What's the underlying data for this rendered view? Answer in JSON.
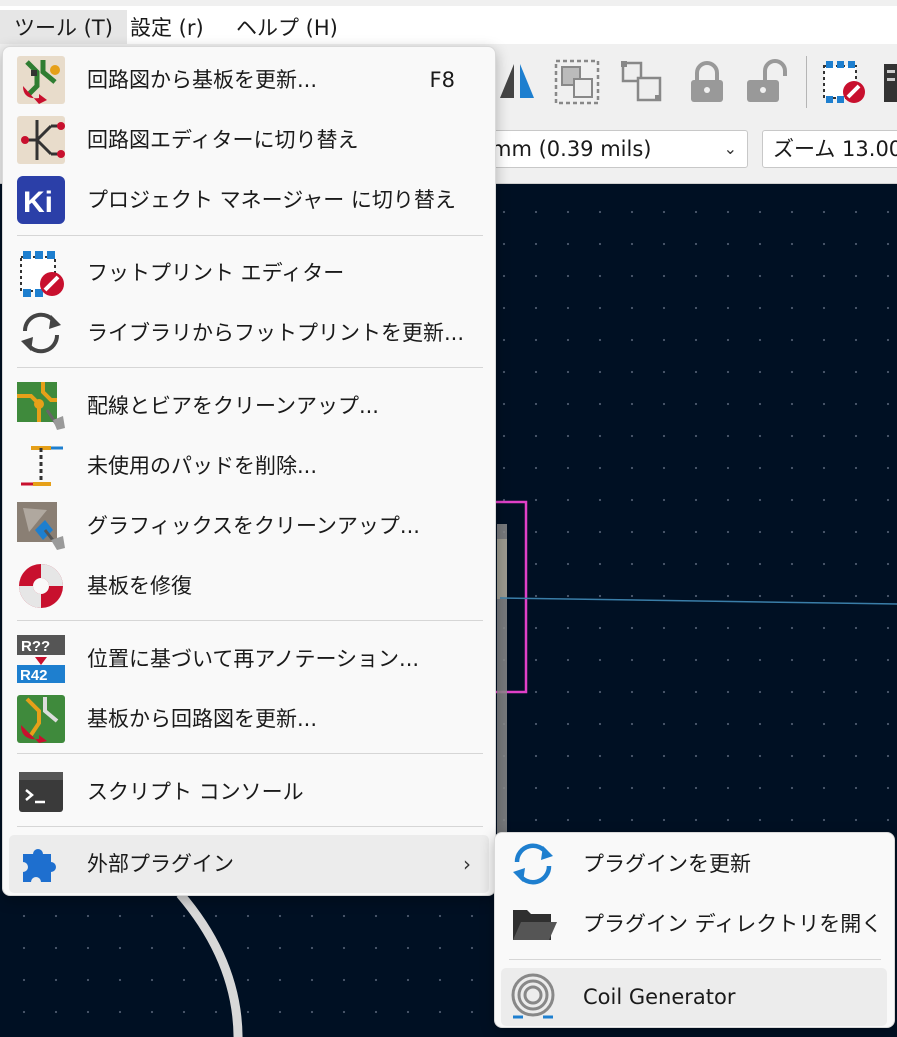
{
  "menubar": {
    "tools": "ツール (T)",
    "settings": "設定 (r)",
    "help": "ヘルプ (H)"
  },
  "toolbar": {
    "grid_value": "mm (0.39 mils)",
    "zoom_value": "ズーム 13.00"
  },
  "tools_menu": {
    "items": [
      {
        "label": "回路図から基板を更新...",
        "shortcut": "F8",
        "icon": "update-pcb-from-schematic-icon"
      },
      {
        "label": "回路図エディターに切り替え",
        "icon": "schematic-editor-icon"
      },
      {
        "label": "プロジェクト マネージャー に切り替え",
        "icon": "kicad-project-manager-icon"
      },
      {
        "label": "フットプリント エディター",
        "icon": "footprint-editor-icon"
      },
      {
        "label": "ライブラリからフットプリントを更新...",
        "icon": "refresh-icon"
      },
      {
        "label": "配線とビアをクリーンアップ...",
        "icon": "cleanup-tracks-icon"
      },
      {
        "label": "未使用のパッドを削除...",
        "icon": "remove-unused-pads-icon"
      },
      {
        "label": "グラフィックスをクリーンアップ...",
        "icon": "cleanup-graphics-icon"
      },
      {
        "label": "基板を修復",
        "icon": "repair-board-icon"
      },
      {
        "label": "位置に基づいて再アノテーション...",
        "icon": "reannotate-icon"
      },
      {
        "label": "基板から回路図を更新...",
        "icon": "update-schematic-from-pcb-icon"
      },
      {
        "label": "スクリプト コンソール",
        "icon": "script-console-icon"
      },
      {
        "label": "外部プラグイン",
        "arrow": "›",
        "icon": "plugin-puzzle-icon"
      }
    ]
  },
  "plugin_menu": {
    "items": [
      {
        "label": "プラグインを更新",
        "icon": "refresh-plugins-icon"
      },
      {
        "label": "プラグイン ディレクトリを開く",
        "icon": "open-folder-icon"
      },
      {
        "label": "Coil Generator",
        "icon": "coil-icon"
      }
    ]
  },
  "colors": {
    "canvas_bg": "#001023",
    "menu_bg": "#f9f9f9",
    "selection_magenta": "#e040c8",
    "track_cyan": "#3a7ea8"
  }
}
